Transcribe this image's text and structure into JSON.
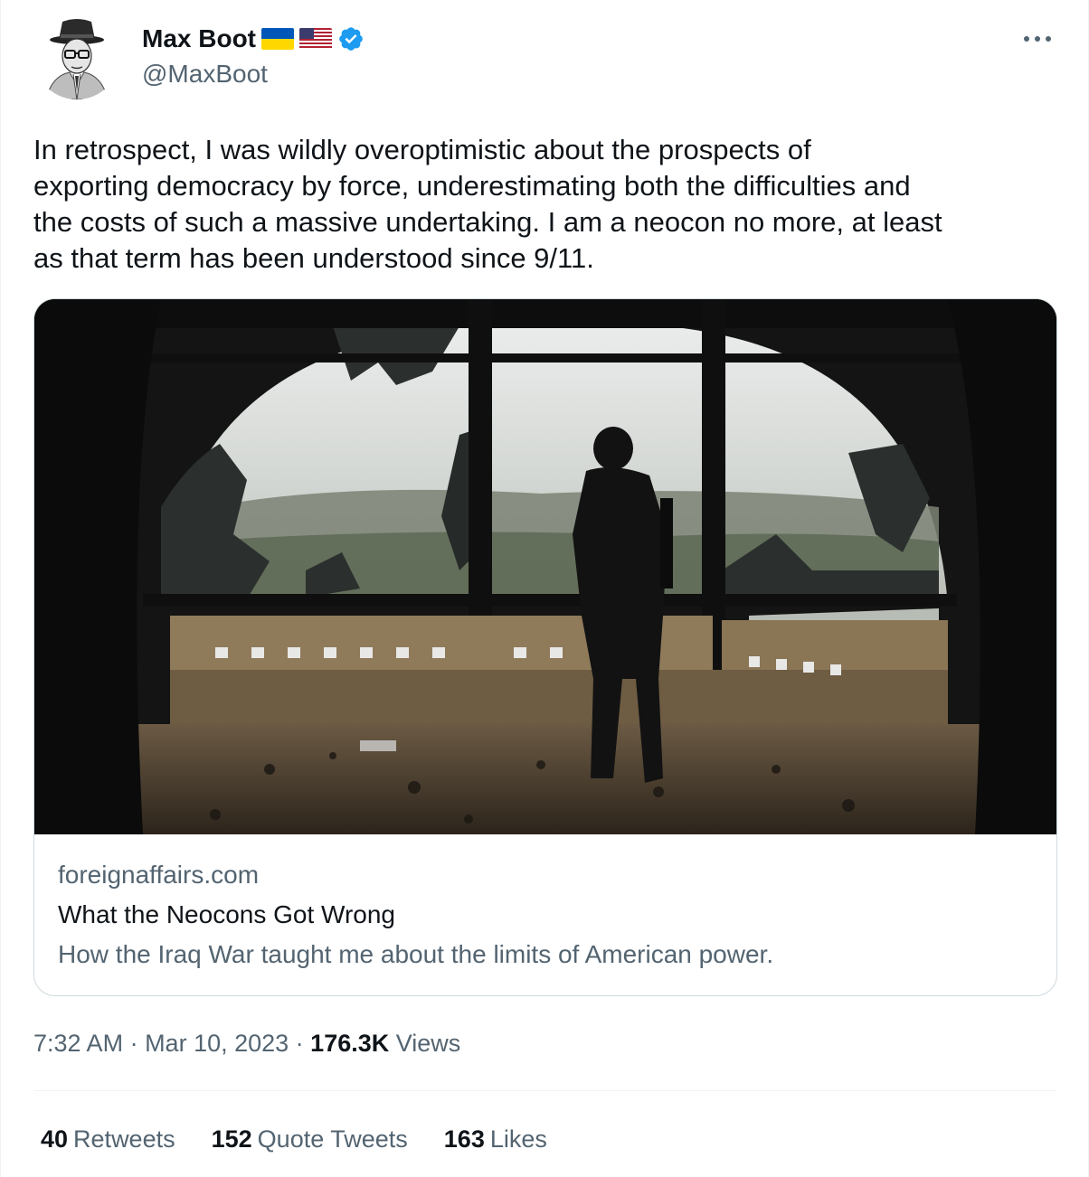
{
  "author": {
    "display_name": "Max Boot",
    "handle": "@MaxBoot",
    "flags": [
      "ukraine-flag-icon",
      "us-flag-icon"
    ],
    "verified": true,
    "verified_color": "#1d9bf0"
  },
  "tweet": {
    "text": "In retrospect, I was wildly overoptimistic about the prospects of\nexporting democracy by force, underestimating both the difficulties and\nthe costs of such a massive undertaking. I am a neocon no more, at least\nas that term has been understood since 9/11."
  },
  "card": {
    "image_icon": "article-photo",
    "domain": "foreignaffairs.com",
    "title": "What the Neocons Got Wrong",
    "description": "How the Iraq War taught me about the limits of American power."
  },
  "meta": {
    "time": "7:32 AM",
    "separator": " · ",
    "date": "Mar 10, 2023",
    "views_count": "176.3K",
    "views_label": "Views"
  },
  "stats": {
    "retweets_count": "40",
    "retweets_label": "Retweets",
    "quotes_count": "152",
    "quotes_label": "Quote Tweets",
    "likes_count": "163",
    "likes_label": "Likes"
  },
  "colors": {
    "text_primary": "#0f1419",
    "text_secondary": "#536471",
    "border": "#cfd9de"
  }
}
